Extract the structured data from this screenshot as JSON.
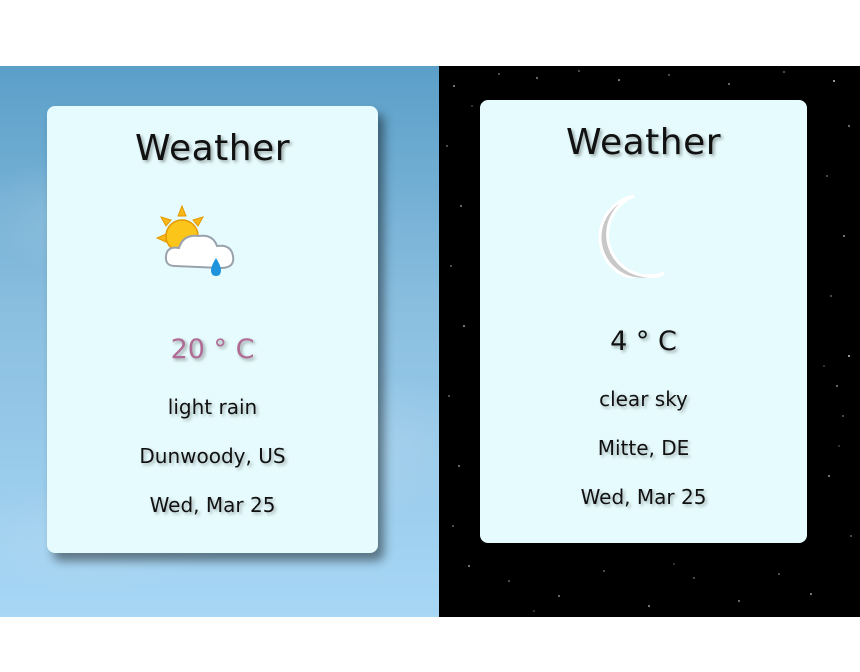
{
  "colors": {
    "card_bg": "#e6fbfd",
    "day_sky_top": "#5b9fc8",
    "day_sky_bottom": "#a7d7f5",
    "night_sky": "#000000",
    "temp_accent": "#b06c94"
  },
  "cards": [
    {
      "title": "Weather",
      "icon": "sun-cloud-rain-icon",
      "temperature": "20 ° C",
      "description": "light rain",
      "location": "Dunwoody, US",
      "date": "Wed, Mar 25"
    },
    {
      "title": "Weather",
      "icon": "crescent-moon-icon",
      "temperature": "4 ° C",
      "description": "clear sky",
      "location": "Mitte, DE",
      "date": "Wed, Mar 25"
    }
  ]
}
